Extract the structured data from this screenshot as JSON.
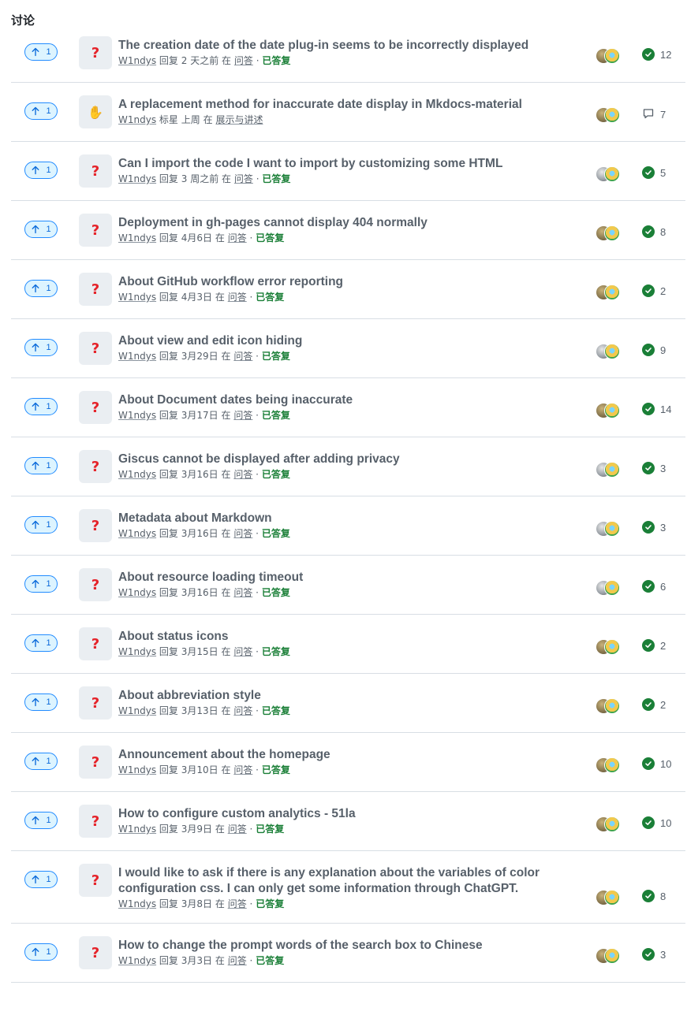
{
  "section_title": "讨论",
  "colors": {
    "accent": "#0969da",
    "answered": "#1a7f37",
    "muted": "#57606a",
    "border": "#d8dee4"
  },
  "discussions": [
    {
      "votes": "1",
      "category_icon": "question-icon",
      "title": "The creation date of the date plug-in seems to be incorrectly displayed",
      "author": "W1ndys",
      "action": "回复",
      "time": "2 天之前",
      "in": "在",
      "category": "问答",
      "sep": "·",
      "answered": "已答复",
      "status_icon": "check-circle-icon",
      "count": "12"
    },
    {
      "votes": "1",
      "category_icon": "raised-hands-icon",
      "title": "A replacement method for inaccurate date display in Mkdocs-material",
      "author": "W1ndys",
      "action": "标星",
      "time": "上周",
      "in": "在",
      "category": "展示与讲述",
      "sep": "",
      "answered": "",
      "status_icon": "comment-icon",
      "count": "7"
    },
    {
      "votes": "1",
      "category_icon": "question-icon",
      "title": "Can I import the code I want to import by customizing some HTML",
      "author": "W1ndys",
      "action": "回复",
      "time": "3 周之前",
      "in": "在",
      "category": "问答",
      "sep": "·",
      "answered": "已答复",
      "status_icon": "check-circle-icon",
      "count": "5"
    },
    {
      "votes": "1",
      "category_icon": "question-icon",
      "title": "Deployment in gh-pages cannot display 404 normally",
      "author": "W1ndys",
      "action": "回复",
      "time": "4月6日",
      "in": "在",
      "category": "问答",
      "sep": "·",
      "answered": "已答复",
      "status_icon": "check-circle-icon",
      "count": "8"
    },
    {
      "votes": "1",
      "category_icon": "question-icon",
      "title": "About GitHub workflow error reporting",
      "author": "W1ndys",
      "action": "回复",
      "time": "4月3日",
      "in": "在",
      "category": "问答",
      "sep": "·",
      "answered": "已答复",
      "status_icon": "check-circle-icon",
      "count": "2"
    },
    {
      "votes": "1",
      "category_icon": "question-icon",
      "title": "About view and edit icon hiding",
      "author": "W1ndys",
      "action": "回复",
      "time": "3月29日",
      "in": "在",
      "category": "问答",
      "sep": "·",
      "answered": "已答复",
      "status_icon": "check-circle-icon",
      "count": "9"
    },
    {
      "votes": "1",
      "category_icon": "question-icon",
      "title": "About Document dates being inaccurate",
      "author": "W1ndys",
      "action": "回复",
      "time": "3月17日",
      "in": "在",
      "category": "问答",
      "sep": "·",
      "answered": "已答复",
      "status_icon": "check-circle-icon",
      "count": "14"
    },
    {
      "votes": "1",
      "category_icon": "question-icon",
      "title": "Giscus cannot be displayed after adding privacy",
      "author": "W1ndys",
      "action": "回复",
      "time": "3月16日",
      "in": "在",
      "category": "问答",
      "sep": "·",
      "answered": "已答复",
      "status_icon": "check-circle-icon",
      "count": "3"
    },
    {
      "votes": "1",
      "category_icon": "question-icon",
      "title": "Metadata about Markdown",
      "author": "W1ndys",
      "action": "回复",
      "time": "3月16日",
      "in": "在",
      "category": "问答",
      "sep": "·",
      "answered": "已答复",
      "status_icon": "check-circle-icon",
      "count": "3"
    },
    {
      "votes": "1",
      "category_icon": "question-icon",
      "title": "About resource loading timeout",
      "author": "W1ndys",
      "action": "回复",
      "time": "3月16日",
      "in": "在",
      "category": "问答",
      "sep": "·",
      "answered": "已答复",
      "status_icon": "check-circle-icon",
      "count": "6"
    },
    {
      "votes": "1",
      "category_icon": "question-icon",
      "title": "About status icons",
      "author": "W1ndys",
      "action": "回复",
      "time": "3月15日",
      "in": "在",
      "category": "问答",
      "sep": "·",
      "answered": "已答复",
      "status_icon": "check-circle-icon",
      "count": "2"
    },
    {
      "votes": "1",
      "category_icon": "question-icon",
      "title": "About abbreviation style",
      "author": "W1ndys",
      "action": "回复",
      "time": "3月13日",
      "in": "在",
      "category": "问答",
      "sep": "·",
      "answered": "已答复",
      "status_icon": "check-circle-icon",
      "count": "2"
    },
    {
      "votes": "1",
      "category_icon": "question-icon",
      "title": "Announcement about the homepage",
      "author": "W1ndys",
      "action": "回复",
      "time": "3月10日",
      "in": "在",
      "category": "问答",
      "sep": "·",
      "answered": "已答复",
      "status_icon": "check-circle-icon",
      "count": "10"
    },
    {
      "votes": "1",
      "category_icon": "question-icon",
      "title": "How to configure custom analytics - 51la",
      "author": "W1ndys",
      "action": "回复",
      "time": "3月9日",
      "in": "在",
      "category": "问答",
      "sep": "·",
      "answered": "已答复",
      "status_icon": "check-circle-icon",
      "count": "10"
    },
    {
      "votes": "1",
      "category_icon": "question-icon",
      "title": "I would like to ask if there is any explanation about the variables of color configuration css. I can only get some information through ChatGPT.",
      "author": "W1ndys",
      "action": "回复",
      "time": "3月8日",
      "in": "在",
      "category": "问答",
      "sep": "·",
      "answered": "已答复",
      "status_icon": "check-circle-icon",
      "count": "8"
    },
    {
      "votes": "1",
      "category_icon": "question-icon",
      "title": "How to change the prompt words of the search box to Chinese",
      "author": "W1ndys",
      "action": "回复",
      "time": "3月3日",
      "in": "在",
      "category": "问答",
      "sep": "·",
      "answered": "已答复",
      "status_icon": "check-circle-icon",
      "count": "3"
    }
  ]
}
